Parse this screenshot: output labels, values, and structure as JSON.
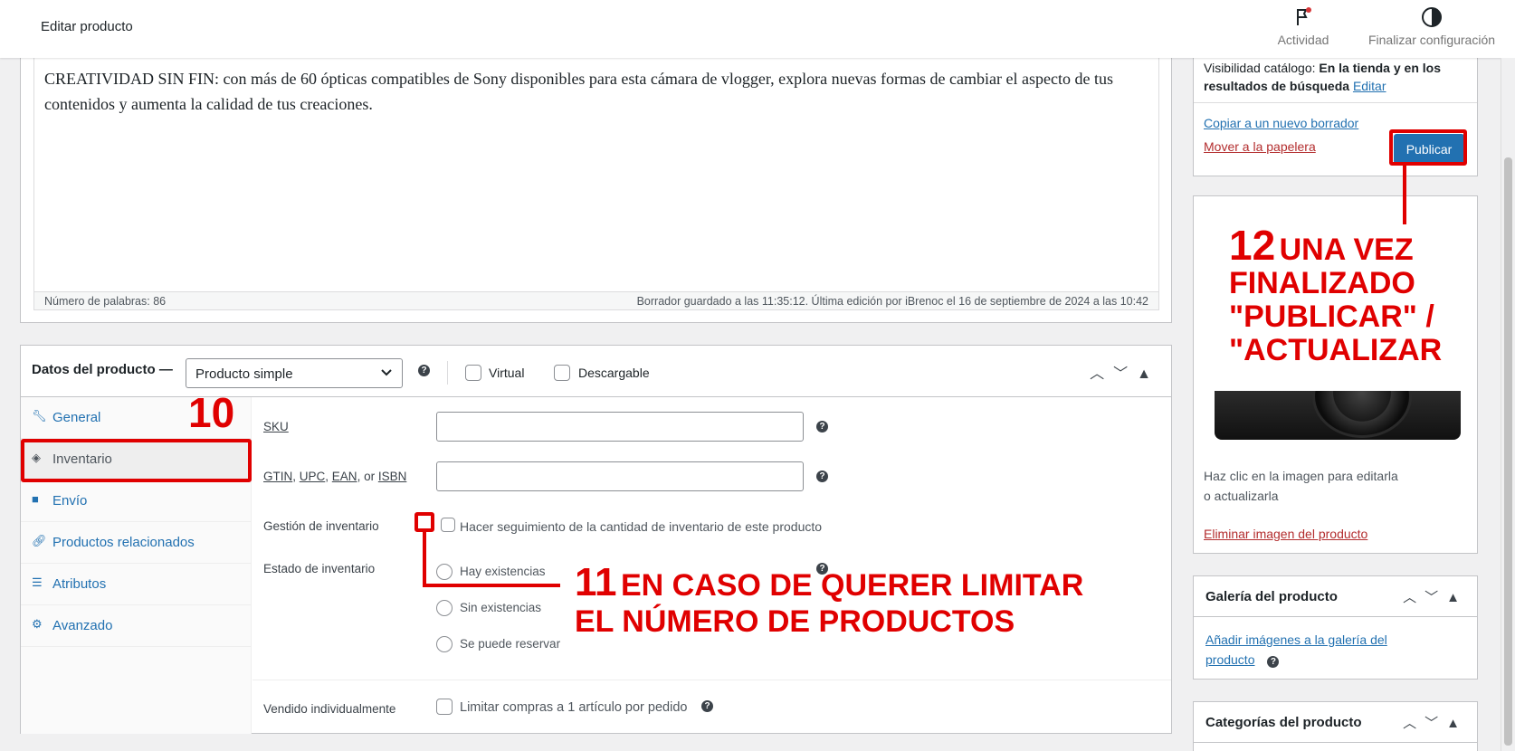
{
  "header": {
    "title": "Editar producto",
    "activity_label": "Actividad",
    "setup_label": "Finalizar configuración"
  },
  "editor": {
    "content": "CREATIVIDAD SIN FIN: con más de 60 ópticas compatibles de Sony disponibles para esta cámara de vlogger, explora nuevas formas de cambiar el aspecto de tus contenidos y aumenta la calidad de tus creaciones.",
    "word_count": "Número de palabras: 86",
    "saved_status": "Borrador guardado a las 11:35:12. Última edición por iBrenoc el 16 de septiembre de 2024 a las 10:42"
  },
  "product_data": {
    "title": "Datos del producto —",
    "type_selected": "Producto simple",
    "virtual_label": "Virtual",
    "downloadable_label": "Descargable",
    "tabs": [
      {
        "label": "General",
        "icon": "wrench-icon"
      },
      {
        "label": "Inventario",
        "icon": "tag-icon"
      },
      {
        "label": "Envío",
        "icon": "truck-icon"
      },
      {
        "label": "Productos relacionados",
        "icon": "link-icon"
      },
      {
        "label": "Atributos",
        "icon": "list-icon"
      },
      {
        "label": "Avanzado",
        "icon": "gear-icon"
      }
    ],
    "active_tab": "Inventario",
    "fields": {
      "sku_label": "SKU",
      "gtin_label_parts": [
        "GTIN",
        ", ",
        "UPC",
        ", ",
        "EAN",
        ", or ",
        "ISBN"
      ],
      "stock_mgmt_label": "Gestión de inventario",
      "stock_mgmt_checkbox": "Hacer seguimiento de la cantidad de inventario de este producto",
      "stock_status_label": "Estado de inventario",
      "stock_options": [
        "Hay existencias",
        "Sin existencias",
        "Se puede reservar"
      ],
      "sold_individually_label": "Vendido individualmente",
      "sold_individually_checkbox": "Limitar compras a 1 artículo por pedido"
    }
  },
  "sidebar": {
    "publish": {
      "visibility_prefix": "Visibilidad catálogo:",
      "visibility_value": "En la tienda y en los resultados de búsqueda",
      "visibility_edit": "Editar",
      "copy_draft": "Copiar a un nuevo borrador",
      "move_trash": "Mover a la papelera",
      "publish_button": "Publicar"
    },
    "image": {
      "help_line1": "Haz clic en la imagen para editarla",
      "help_line2": "o actualizarla",
      "remove": "Eliminar imagen del producto"
    },
    "gallery": {
      "title": "Galería del producto",
      "add_line1": "Añadir imágenes a la galería del",
      "add_line2": "producto"
    },
    "categories": {
      "title": "Categorías del producto"
    }
  },
  "annotations": {
    "step10": "10",
    "step11_num": "11",
    "step11_line1": "EN CASO DE QUERER LIMITAR",
    "step11_line2": "EL NÚMERO DE PRODUCTOS",
    "step12_num": "12",
    "step12_line1": "UNA VEZ",
    "step12_line2": "FINALIZADO",
    "step12_line3": "\"PUBLICAR\" /",
    "step12_line4": "\"ACTUALIZAR",
    "color": "#e00000"
  }
}
